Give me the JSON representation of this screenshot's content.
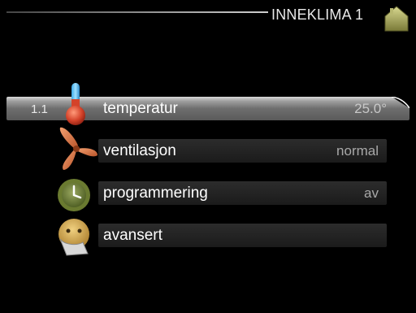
{
  "header": {
    "title": "INNEKLIMA 1",
    "home_icon": "house-icon"
  },
  "menu": {
    "items": [
      {
        "number": "1.1",
        "label": "temperatur",
        "value": "25.0°",
        "icon": "thermometer-icon",
        "selected": true
      },
      {
        "label": "ventilasjon",
        "value": "normal",
        "icon": "fan-icon",
        "selected": false
      },
      {
        "label": "programmering",
        "value": "av",
        "icon": "clock-icon",
        "selected": false
      },
      {
        "label": "avansert",
        "value": "",
        "icon": "advanced-face-icon",
        "selected": false
      }
    ]
  },
  "colors": {
    "background": "#000000",
    "selected_bar": "#8a8a8a",
    "row_bar": "#222222",
    "home_icon": "#a8a860",
    "thermometer_bulb": "#c8442a",
    "fan": "#e07a40",
    "clock": "#7a8a40",
    "advanced": "#c8a040"
  }
}
